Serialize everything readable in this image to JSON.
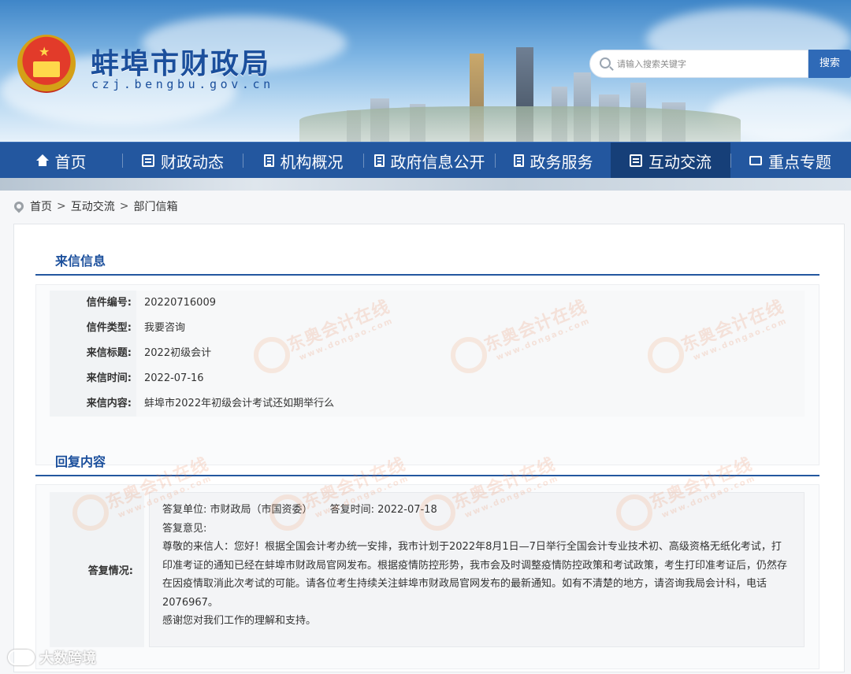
{
  "site": {
    "title": "蚌埠市财政局",
    "domain": "czj.bengbu.gov.cn"
  },
  "search": {
    "placeholder": "请输入搜索关键字",
    "button_label": "搜索"
  },
  "nav": {
    "items": [
      {
        "label": "首页",
        "icon": "home-icon"
      },
      {
        "label": "财政动态",
        "icon": "newspaper-icon"
      },
      {
        "label": "机构概况",
        "icon": "list-icon"
      },
      {
        "label": "政府信息公开",
        "icon": "document-icon"
      },
      {
        "label": "政务服务",
        "icon": "edit-document-icon"
      },
      {
        "label": "互动交流",
        "icon": "chat-document-icon",
        "active": true
      },
      {
        "label": "重点专题",
        "icon": "folder-icon"
      }
    ]
  },
  "breadcrumb": {
    "items": [
      "首页",
      "互动交流",
      "部门信箱"
    ],
    "separator": ">"
  },
  "letter": {
    "section_title": "来信信息",
    "fields": [
      {
        "label": "信件编号:",
        "value": "20220716009"
      },
      {
        "label": "信件类型:",
        "value": "我要咨询"
      },
      {
        "label": "来信标题:",
        "value": "2022初级会计"
      },
      {
        "label": "来信时间:",
        "value": "2022-07-16"
      },
      {
        "label": "来信内容:",
        "value": "蚌埠市2022年初级会计考试还如期举行么"
      }
    ]
  },
  "reply": {
    "section_title": "回复内容",
    "label": "答复情况:",
    "unit": "答复单位:   市财政局（市国资委）",
    "time": "答复时间:   2022-07-18",
    "opinion_label": "答复意见:",
    "body": "尊敬的来信人：您好！根据全国会计考办统一安排，我市计划于2022年8月1日—7日举行全国会计专业技术初、高级资格无纸化考试，打印准考证的通知已经在蚌埠市财政局官网发布。根据疫情防控形势，我市会及时调整疫情防控政策和考试政策，考生打印准考证后，仍然存在因疫情取消此次考试的可能。请各位考生持续关注蚌埠市财政局官网发布的最新通知。如有不清楚的地方，请咨询我局会计科，电话2076967。",
    "closing": "感谢您对我们工作的理解和支持。"
  },
  "watermarks": {
    "brand": "东奥会计在线",
    "url": "www.dongao.com",
    "corner": "大数跨境"
  },
  "colors": {
    "nav_bg": "#23579f",
    "nav_active": "#163f78",
    "title_blue": "#1b4f9c",
    "search_button": "#2f6ab7"
  }
}
